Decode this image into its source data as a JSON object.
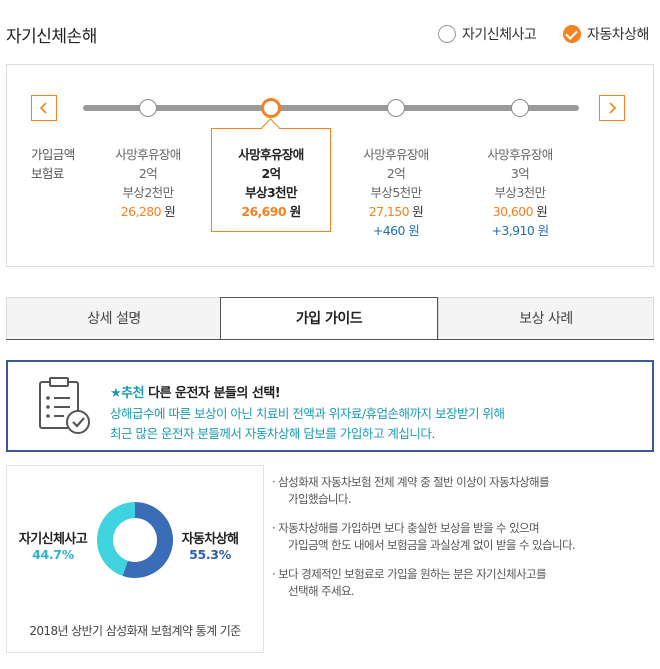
{
  "header": {
    "title": "자기신체손해",
    "options": [
      {
        "label": "자기신체사고",
        "checked": false
      },
      {
        "label": "자동차상해",
        "checked": true
      }
    ]
  },
  "slider": {
    "row_labels": [
      "가입금액",
      "보험료"
    ],
    "options": [
      {
        "line1": "사망후유장애",
        "line2": "2억",
        "line3": "부상2천만",
        "price": "26,280",
        "unit": "원",
        "diff": "",
        "selected": false
      },
      {
        "line1": "사망후유장애",
        "line2": "2억",
        "line3": "부상3천만",
        "price": "26,690",
        "unit": "원",
        "diff": "",
        "selected": true
      },
      {
        "line1": "사망후유장애",
        "line2": "2억",
        "line3": "부상5천만",
        "price": "27,150",
        "unit": "원",
        "diff": "+460 원",
        "selected": false
      },
      {
        "line1": "사망후유장애",
        "line2": "3억",
        "line3": "부상3천만",
        "price": "30,600",
        "unit": "원",
        "diff": "+3,910 원",
        "selected": false
      }
    ]
  },
  "tabs": [
    {
      "label": "상세 설명",
      "active": false
    },
    {
      "label": "가입 가이드",
      "active": true
    },
    {
      "label": "보상 사례",
      "active": false
    }
  ],
  "recommend": {
    "badge": "추천",
    "headline": "다른 운전자 분들의 선택!",
    "line2": "상해급수에 따른 보상이 아닌 치료비 전액과 위자료/휴업손해까지 보장받기 위해",
    "line3": "최근 많은 운전자 분들께서 자동차상해 담보를 가입하고 계십니다."
  },
  "chart_data": {
    "type": "pie",
    "categories": [
      "자기신체사고",
      "자동차상해"
    ],
    "values": [
      44.7,
      55.3
    ],
    "value_labels": [
      "44.7%",
      "55.3%"
    ],
    "colors": [
      "#3fd3df",
      "#3a6db5"
    ],
    "caption": "2018년 상반기 삼성화재 보험계약 통계 기준"
  },
  "notes": [
    {
      "line1": "· 삼성화재 자동차보험 전체 계약 중 절반 이상이 자동차상해를",
      "line2": "가입했습니다."
    },
    {
      "line1": "· 자동차상해를 가입하면 보다 충실한 보상을 받을 수 있으며",
      "line2": "가입금액 한도 내에서 보험금을 과실상계 없이 받을 수 있습니다."
    },
    {
      "line1": "· 보다 경제적인 보험료로 가입을 원하는 분은 자기신체사고를",
      "line2": "선택해 주세요."
    }
  ]
}
